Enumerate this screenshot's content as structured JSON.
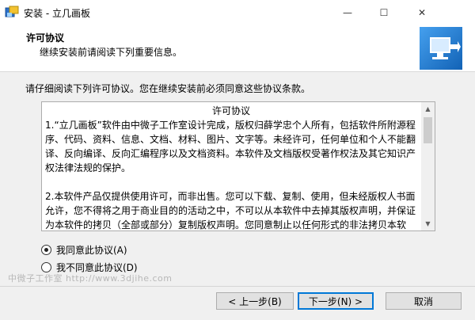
{
  "window": {
    "title": "安装 - 立几画板",
    "icon": "installer-icon",
    "controls": {
      "minimize": "—",
      "maximize": "☐",
      "close": "✕"
    }
  },
  "header": {
    "title": "许可协议",
    "subtitle": "继续安装前请阅读下列重要信息。",
    "logo_icon": "computer-setup-icon"
  },
  "intro": "请仔细阅读下列许可协议。您在继续安装前必须同意这些协议条款。",
  "license": {
    "title": "许可协议",
    "paragraphs": [
      "1.“立几画板”软件由中微子工作室设计完成，版权归薛学忠个人所有，包括软件所附源程序、代码、资料、信息、文档、材料、图片、文字等。未经许可，任何单位和个人不能翻译、反向编译、反向汇编程序以及文档资料。本软件及文档版权受著作权法及其它知识产权法律法规的保护。",
      "2.本软件产品仅提供使用许可，而非出售。您可以下载、复制、使用，但未经版权人书面允许，您不得将之用于商业目的的活动之中，不可以从本软件中去掉其版权声明，并保证为本软件的拷贝（全部或部分）复制版权声明。您同意制止以任何形式的非法拷贝本软件。"
    ]
  },
  "options": {
    "accept": "我同意此协议(A)",
    "decline": "我不同意此协议(D)",
    "selected": "accept"
  },
  "watermark": "中微子工作室 http://www.3djihe.com",
  "buttons": {
    "back": "< 上一步(B)",
    "next": "下一步(N) >",
    "cancel": "取消"
  },
  "colors": {
    "focus_border": "#0078d7",
    "background": "#f0f0f0"
  }
}
